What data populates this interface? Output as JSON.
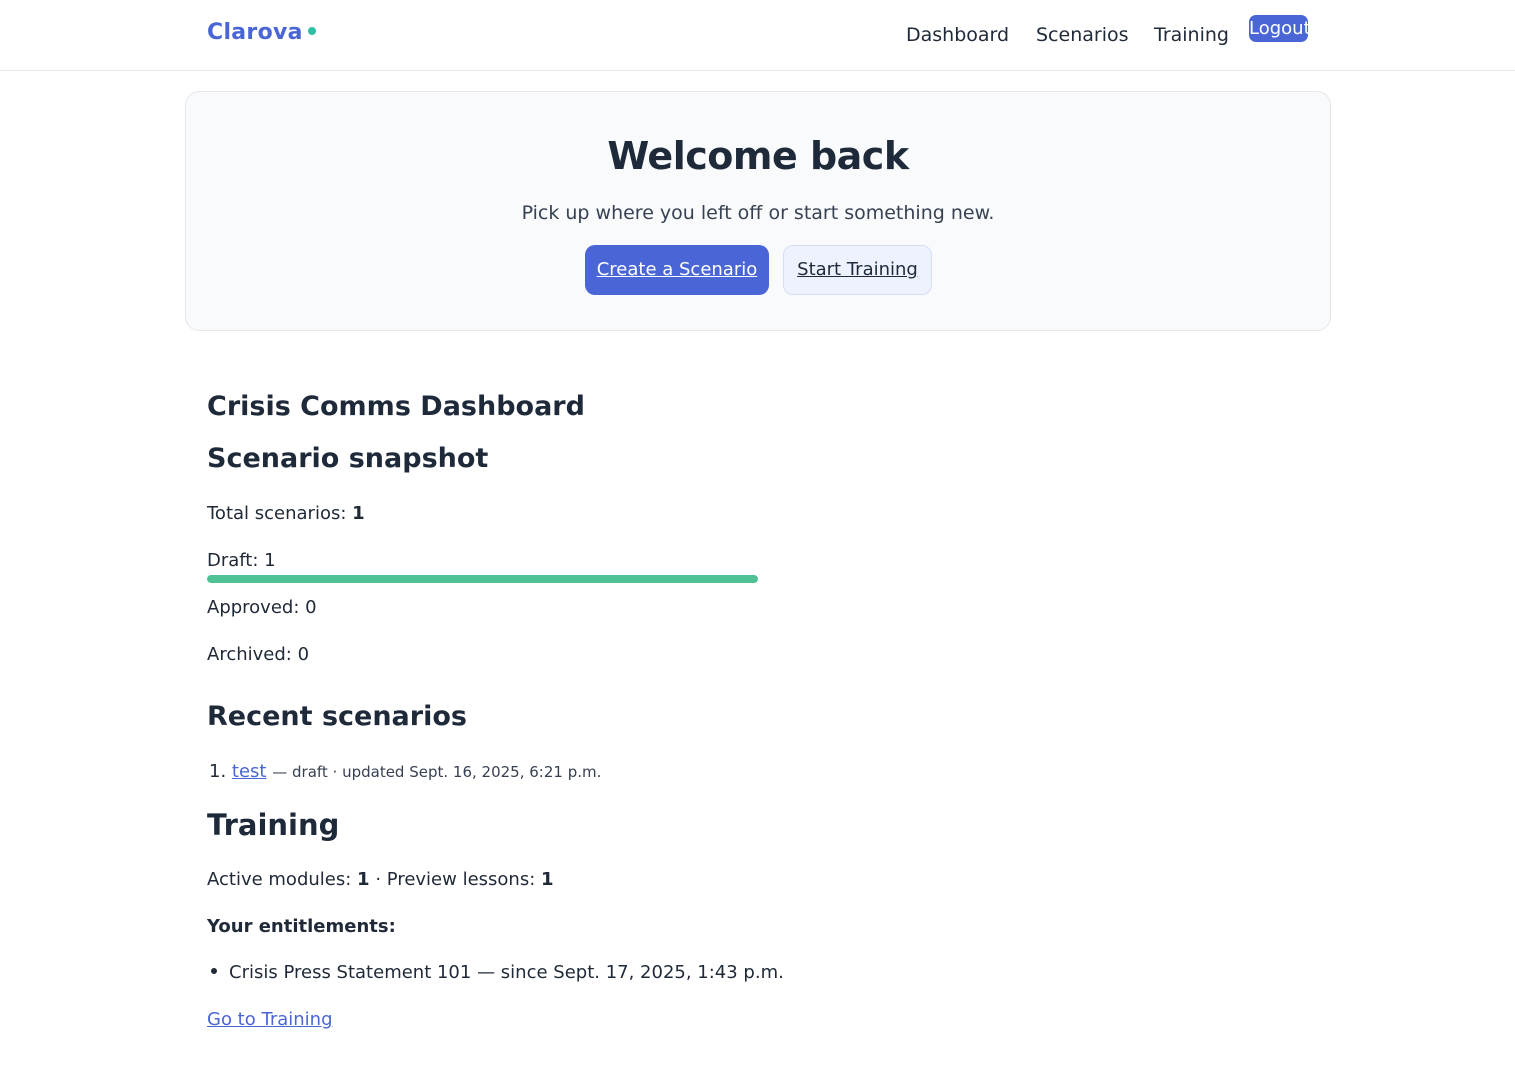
{
  "brand": {
    "name": "Clarova"
  },
  "nav": {
    "dashboard": "Dashboard",
    "scenarios": "Scenarios",
    "training": "Training",
    "logout": "Logout"
  },
  "hero": {
    "title": "Welcome back",
    "subtitle": "Pick up where you left off or start something new.",
    "primary_button": "Create a Scenario",
    "secondary_button": "Start Training"
  },
  "dashboard": {
    "title": "Crisis Comms Dashboard",
    "snapshot": {
      "heading": "Scenario snapshot",
      "total_label": "Total scenarios:",
      "total_value": "1",
      "draft_text": "Draft: 1",
      "draft_fraction": 1.0,
      "approved_text": "Approved: 0",
      "archived_text": "Archived: 0"
    },
    "recent": {
      "heading": "Recent scenarios",
      "items": [
        {
          "index": "1.",
          "name": "test",
          "meta": "— draft · updated Sept. 16, 2025, 6:21 p.m."
        }
      ]
    },
    "training": {
      "heading": "Training",
      "active_label": "Active modules:",
      "active_value": "1",
      "sep": "·",
      "preview_label": "Preview lessons:",
      "preview_value": "1",
      "entitlements_label": "Your entitlements:",
      "entitlements": [
        {
          "text": "Crisis Press Statement 101 — since Sept. 17, 2025, 1:43 p.m."
        }
      ],
      "go_link": "Go to Training"
    }
  },
  "colors": {
    "accent": "#4a66d6",
    "progress": "#4fc194",
    "brand_dot": "#2ebfa5"
  }
}
